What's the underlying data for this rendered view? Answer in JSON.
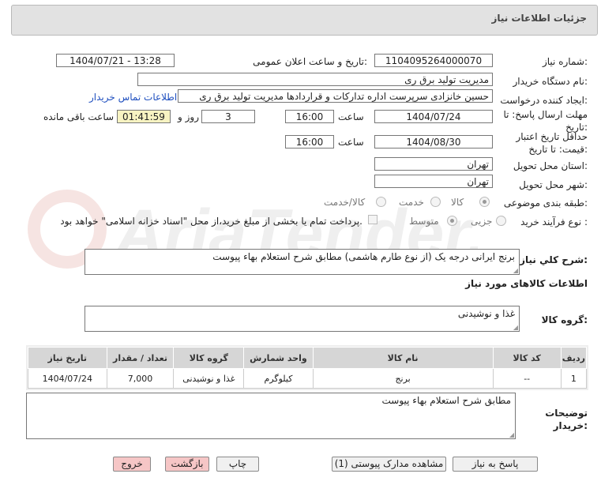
{
  "header": {
    "title": "جزئیات اطلاعات نیاز"
  },
  "form": {
    "need_number_label": "شماره نیاز:",
    "need_number": "1104095264000070",
    "announce_label": "تاریخ و ساعت اعلان عمومی:",
    "announce_value": "1404/07/21 - 13:28",
    "buyer_label": "نام دستگاه خریدار:",
    "buyer": "مدیریت تولید برق ری",
    "creator_label": "ایجاد کننده درخواست:",
    "creator": "حسین خانزادی سرپرست اداره تدارکات و قراردادها مدیریت تولید برق ری",
    "contact_link": "اطلاعات تماس خریدار",
    "deadline_label_1": "مهلت ارسال پاسخ: تا",
    "deadline_label_2": "تاریخ:",
    "deadline_date": "1404/07/24",
    "time_label": "ساعت",
    "deadline_time": "16:00",
    "days_value": "3",
    "days_label": "روز و",
    "remaining_value": "01:41:59",
    "remaining_label": "ساعت باقی مانده",
    "validity_label_1": "حداقل تاریخ اعتبار",
    "validity_label_2": "قیمت: تا تاریخ:",
    "validity_date": "1404/08/30",
    "validity_time": "16:00",
    "province_label": "استان محل تحویل:",
    "province": "تهران",
    "city_label": "شهر محل تحویل:",
    "city": "تهران",
    "category_label": "طبقه بندی موضوعی:",
    "category_options": [
      "کالا",
      "خدمت",
      "کالا/خدمت"
    ],
    "purchase_type_label": "نوع فرآیند خرید :",
    "purchase_options": [
      "جزیی",
      "متوسط"
    ],
    "payment_note": "پرداخت تمام یا بخشی از مبلغ خرید،از محل \"اسناد خزانه اسلامی\" خواهد بود.",
    "general_desc_label": "شرح کلي نياز:",
    "general_desc": "برنج ایرانی درجه یک (از نوع طارم هاشمی) مطابق شرح استعلام بهاء پیوست",
    "goods_info_title": "اطلاعات کالاهای مورد نیاز",
    "goods_group_label": "گروه کالا:",
    "goods_group": "غذا و نوشیدنی",
    "buyer_notes_label_1": "توضیحات",
    "buyer_notes_label_2": "خریدار:",
    "buyer_notes": "مطابق شرح استعلام بهاء پیوست"
  },
  "table": {
    "headers": [
      "ردیف",
      "کد کالا",
      "نام کالا",
      "واحد شمارش",
      "گروه کالا",
      "تعداد / مقدار",
      "تاریخ نیاز"
    ],
    "rows": [
      [
        "1",
        "--",
        "برنج",
        "کیلوگرم",
        "غذا و نوشیدنی",
        "7,000",
        "1404/07/24"
      ]
    ]
  },
  "buttons": {
    "reply": "پاسخ به نیاز",
    "attachments": "مشاهده مدارک پیوستی (1)",
    "print": "چاپ",
    "back": "بازگشت",
    "exit": "خروج"
  },
  "watermark": {
    "text": "AriaTender.neT",
    "color": "#c0392b"
  }
}
